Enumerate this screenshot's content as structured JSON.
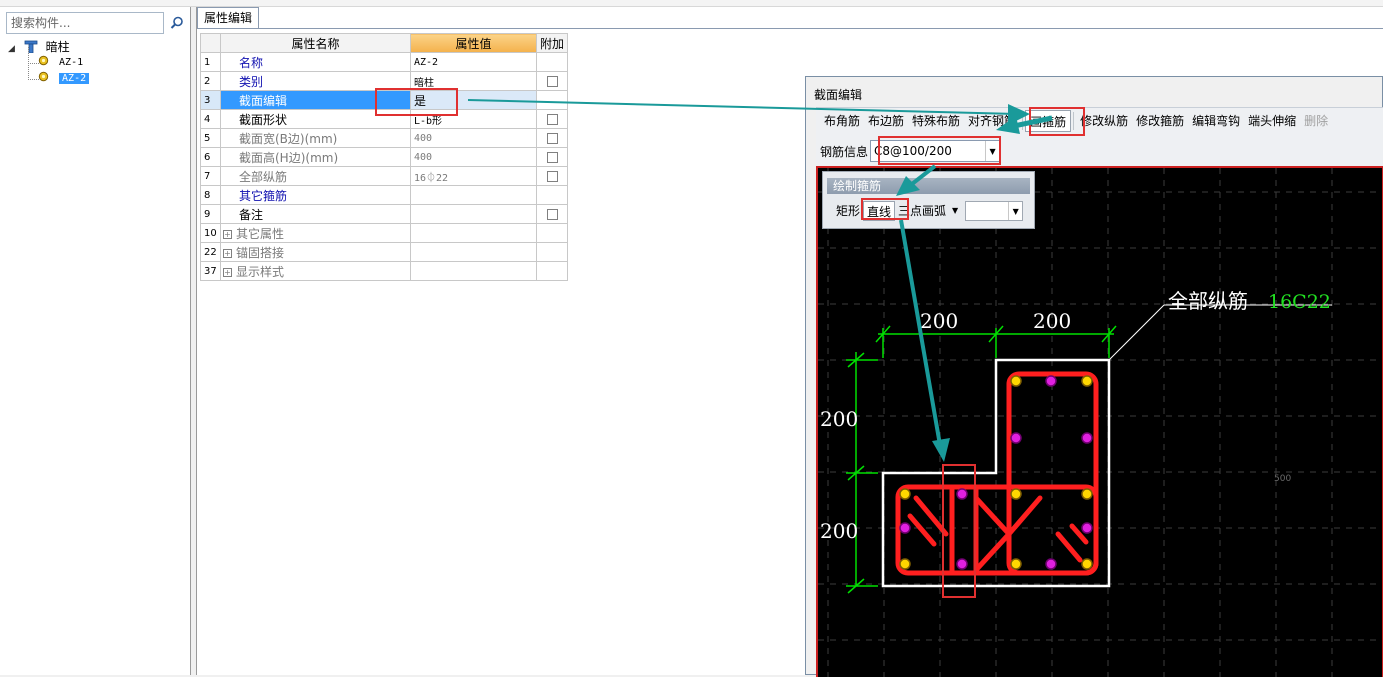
{
  "search": {
    "placeholder": "搜索构件..."
  },
  "tree": {
    "root_label": "暗柱",
    "children": [
      {
        "label": "AZ-1",
        "selected": false
      },
      {
        "label": "AZ-2",
        "selected": true
      }
    ]
  },
  "property_panel": {
    "tab_label": "属性编辑",
    "headers": {
      "name": "属性名称",
      "value": "属性值",
      "extra": "附加"
    },
    "rows": [
      {
        "num": "1",
        "name": "名称",
        "value": "AZ-2"
      },
      {
        "num": "2",
        "name": "类别",
        "value": "暗柱"
      },
      {
        "num": "3",
        "name": "截面编辑",
        "value": "是"
      },
      {
        "num": "4",
        "name": "截面形状",
        "value": "L-b形"
      },
      {
        "num": "5",
        "name": "截面宽(B边)(mm)",
        "value": "400"
      },
      {
        "num": "6",
        "name": "截面高(H边)(mm)",
        "value": "400"
      },
      {
        "num": "7",
        "name": "全部纵筋",
        "value": "16⏀22"
      },
      {
        "num": "8",
        "name": "其它箍筋",
        "value": ""
      },
      {
        "num": "9",
        "name": "备注",
        "value": ""
      },
      {
        "num": "10",
        "name": "其它属性",
        "value": ""
      },
      {
        "num": "22",
        "name": "锚固搭接",
        "value": ""
      },
      {
        "num": "37",
        "name": "显示样式",
        "value": ""
      }
    ]
  },
  "section_editor": {
    "title": "截面编辑",
    "toolbar": {
      "corner": "布角筋",
      "edge": "布边筋",
      "special": "特殊布筋",
      "align": "对齐钢筋",
      "draw_stirrup": "画箍筋",
      "modify_long": "修改纵筋",
      "modify_stirrup": "修改箍筋",
      "edit_hook": "编辑弯钩",
      "end_extend": "端头伸缩",
      "delete": "删除"
    },
    "rebar_info_label": "钢筋信息",
    "rebar_info_value": "C8@100/200",
    "draw_panel": {
      "title": "绘制箍筋",
      "rect": "矩形",
      "line": "直线",
      "arc": "三点画弧"
    },
    "canvas": {
      "dim_top_left": "200",
      "dim_top_right": "200",
      "dim_left_upper": "200",
      "dim_left_lower": "200",
      "label_all_rebar": "全部纵筋",
      "label_all_rebar_value": "16C22",
      "axis_mark": "500"
    }
  },
  "colors": {
    "canvas_bg": "#000000",
    "stirrup": "#ff1f1f",
    "outline": "#ffffff",
    "dimension": "#00e000",
    "rebar_corner": "#ffd700",
    "rebar_edge": "#e020e0",
    "highlight_box": "#e03030",
    "annotation_arrow": "#1a9a9a",
    "selection_blue": "#3399ff"
  }
}
